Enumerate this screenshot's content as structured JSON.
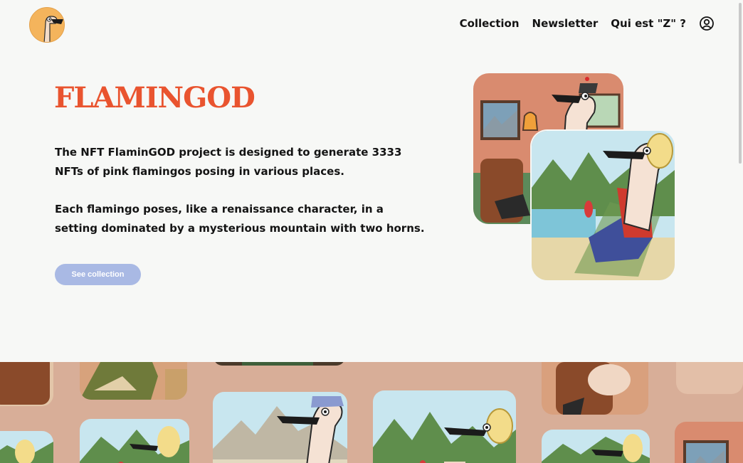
{
  "header": {
    "logo_alt": "FlaminGOD flamingo logo",
    "nav": [
      "Collection",
      "Newsletter",
      "Qui est \"Z\" ?"
    ],
    "account_icon": "user-circle-icon"
  },
  "hero": {
    "brand": "FLAMINGOD",
    "paragraphs": [
      "The NFT FlaminGOD project is designed to generate 3333 NFTs of pink flamingos posing in various places.",
      "Each flamingo poses, like a renaissance character, in a setting dominated by a mysterious mountain with two horns."
    ],
    "cta": "See collection",
    "artworks": [
      "flamingo-with-cap-in-room",
      "flamingo-with-wig-on-deckchair"
    ]
  },
  "gallery": {
    "items": [
      "flamingo-armchair",
      "flamingo-green-suit",
      "flamingo-dark",
      "flamingo-cap-mountains",
      "flamingo-wig-mountains",
      "flamingo-wig-armchair",
      "flamingo-wig-small",
      "flamingo-room"
    ]
  },
  "colors": {
    "background": "#f7f8f6",
    "brand": "#e9542f",
    "cta": "#a9b9e4",
    "gallery_band": "#d8ae98"
  }
}
